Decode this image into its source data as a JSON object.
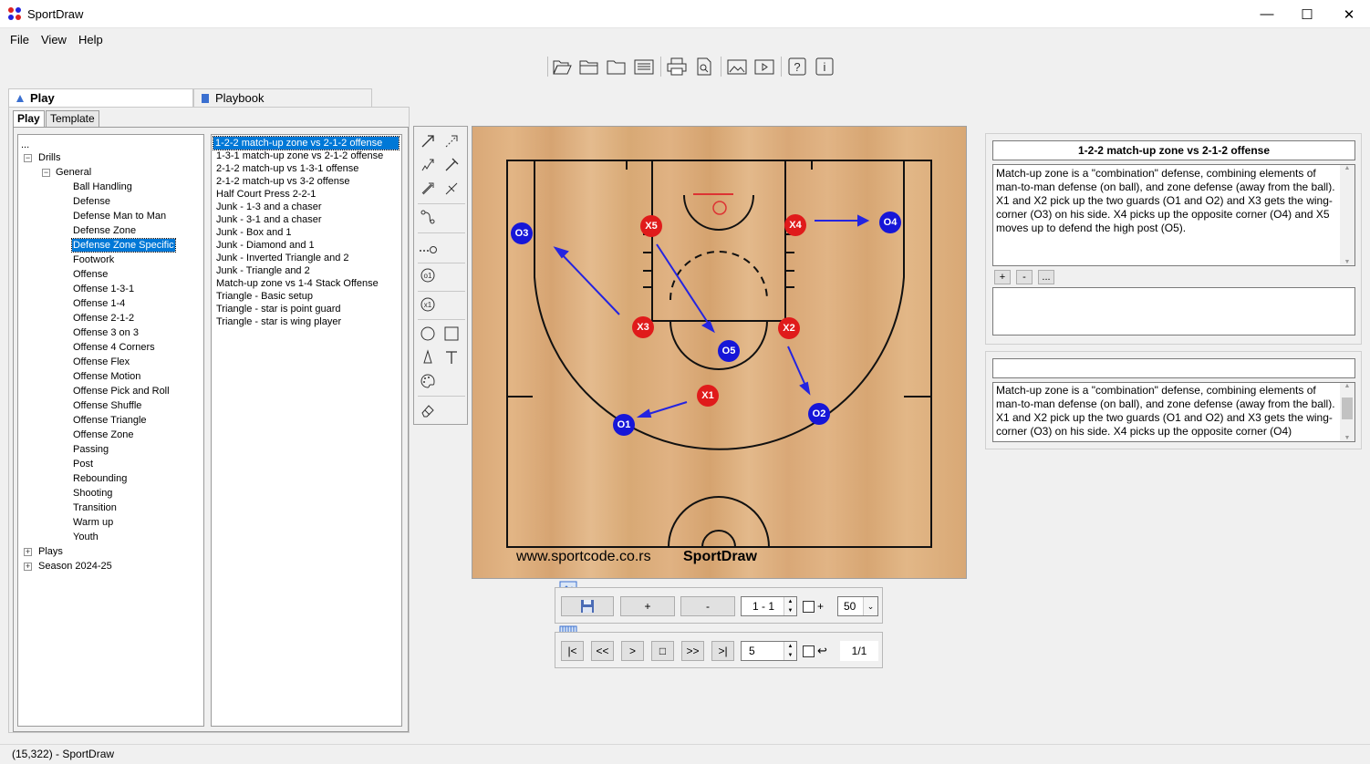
{
  "window": {
    "title": "SportDraw",
    "minimize": "—",
    "maximize": "☐",
    "close": "✕"
  },
  "menu": [
    "File",
    "View",
    "Help"
  ],
  "toolbar": {
    "icons": [
      "open-file-icon",
      "open-folder-icon",
      "folder-icon",
      "list-icon",
      "print-icon",
      "print-preview-icon",
      "image-icon",
      "video-icon",
      "help-icon",
      "info-icon"
    ]
  },
  "tabs": {
    "main": [
      "Play",
      "Playbook"
    ],
    "sub": [
      "Play",
      "Template"
    ]
  },
  "tree": {
    "root": "...",
    "drills": "Drills",
    "general": "General",
    "items": [
      "Ball Handling",
      "Defense",
      "Defense Man to Man",
      "Defense Zone",
      "Defense Zone Specific",
      "Footwork",
      "Offense",
      "Offense 1-3-1",
      "Offense 1-4",
      "Offense 2-1-2",
      "Offense 3 on 3",
      "Offense 4 Corners",
      "Offense Flex",
      "Offense Motion",
      "Offense Pick and Roll",
      "Offense Shuffle",
      "Offense Triangle",
      "Offense Zone",
      "Passing",
      "Post",
      "Rebounding",
      "Shooting",
      "Transition",
      "Warm up",
      "Youth"
    ],
    "selected_index": 4,
    "plays": "Plays",
    "season": "Season 2024-25"
  },
  "plays_list": {
    "items": [
      "1-2-2 match-up zone vs 2-1-2 offense",
      "1-3-1 match-up zone vs 2-1-2 offense",
      "2-1-2 match-up vs 1-3-1 offense",
      "2-1-2 match-up vs 3-2 offense",
      "Half Court Press 2-2-1",
      "Junk - 1-3 and a chaser",
      "Junk - 3-1 and a chaser",
      "Junk - Box and 1",
      "Junk - Diamond and 1",
      "Junk - Inverted Triangle and 2",
      "Junk - Triangle and 2",
      "Match-up zone vs 1-4 Stack Offense",
      "Triangle - Basic setup",
      "Triangle - star is point guard",
      "Triangle - star is wing player"
    ],
    "selected_index": 0
  },
  "court": {
    "website": "www.sportcode.co.rs",
    "brand": "SportDraw",
    "players": [
      {
        "label": "O3",
        "team": "offense"
      },
      {
        "label": "X5",
        "team": "defense"
      },
      {
        "label": "X4",
        "team": "defense"
      },
      {
        "label": "O4",
        "team": "offense"
      },
      {
        "label": "X3",
        "team": "defense"
      },
      {
        "label": "X2",
        "team": "defense"
      },
      {
        "label": "O5",
        "team": "offense"
      },
      {
        "label": "X1",
        "team": "defense"
      },
      {
        "label": "O1",
        "team": "offense"
      },
      {
        "label": "O2",
        "team": "offense"
      }
    ],
    "colors": {
      "offense": "#1616d8",
      "defense": "#e01b1b",
      "arrow": "#2424e0"
    }
  },
  "frame_controls": {
    "add": "+",
    "remove": "-",
    "frame": "1 - 1",
    "plus_label": "+",
    "zoom": "50"
  },
  "playback": {
    "first": "|<",
    "prev": "<<",
    "play": ">",
    "stop": "□",
    "next": ">>",
    "last": ">|",
    "speed": "5",
    "loop_label": "↩",
    "page": "1/1"
  },
  "description": {
    "title": "1-2-2 match-up zone vs 2-1-2 offense",
    "text": "Match-up zone is a \"combination\" defense, combining elements of man-to-man defense (on ball), and zone defense (away from the ball). X1 and X2 pick up the two guards (O1 and O2) and X3 gets the wing-corner (O3) on his side. X4 picks up the opposite corner (O4) and X5 moves up to defend the high post (O5).",
    "btn_add": "+",
    "btn_remove": "-",
    "btn_more": "..."
  },
  "frame_description": {
    "title": "",
    "text": "Match-up zone is a \"combination\" defense, combining elements of man-to-man defense (on ball), and zone defense (away from the ball). X1 and X2 pick up the two guards (O1 and O2) and X3 gets the wing-corner (O3) on his side. X4 picks up the opposite corner (O4)"
  },
  "status": "(15,322) - SportDraw"
}
